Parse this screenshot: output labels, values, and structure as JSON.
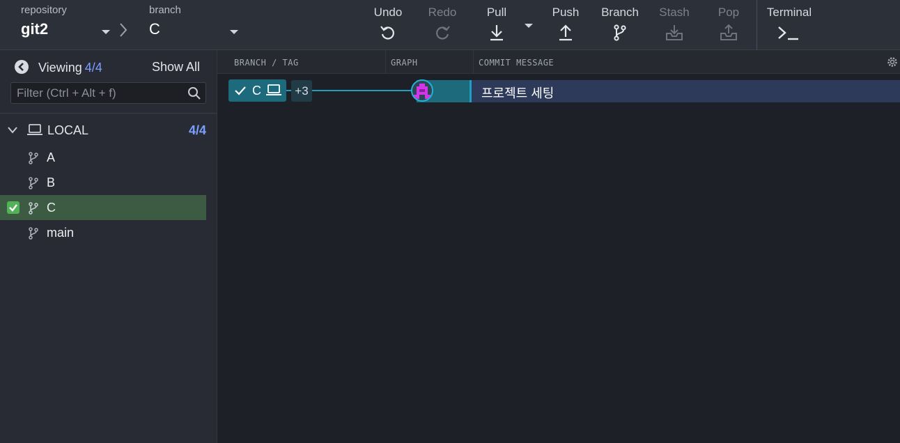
{
  "toolbar": {
    "repository_label": "repository",
    "repository_value": "git2",
    "branch_label": "branch",
    "branch_value": "C",
    "buttons": {
      "undo": "Undo",
      "redo": "Redo",
      "pull": "Pull",
      "push": "Push",
      "branch": "Branch",
      "stash": "Stash",
      "pop": "Pop",
      "terminal": "Terminal"
    }
  },
  "sidebar": {
    "viewing_label": "Viewing",
    "viewing_count": "4/4",
    "show_all": "Show All",
    "filter_placeholder": "Filter (Ctrl + Alt + f)",
    "local_label": "LOCAL",
    "local_count": "4/4",
    "branches": [
      {
        "name": "A",
        "active": false
      },
      {
        "name": "B",
        "active": false
      },
      {
        "name": "C",
        "active": true
      },
      {
        "name": "main",
        "active": false
      }
    ]
  },
  "main": {
    "columns": {
      "branch_tag": "BRANCH / TAG",
      "graph": "GRAPH",
      "commit_message": "COMMIT MESSAGE"
    },
    "commits": [
      {
        "branch": "C",
        "extra_refs": "+3",
        "message": "프로젝트 세팅"
      }
    ]
  },
  "colors": {
    "accent": "#1e9fc0",
    "count_blue": "#7aa0ff",
    "active_branch_bg": "#3c5b42",
    "check_green": "#52b257"
  }
}
